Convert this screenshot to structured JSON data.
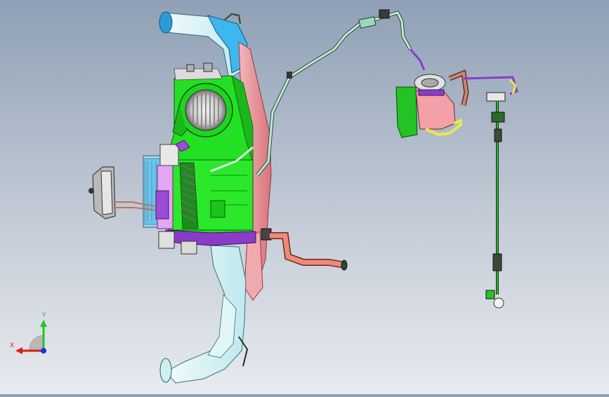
{
  "viewport": {
    "colors": {
      "background_top": "#8fa0b6",
      "background_bottom": "#e8ebef",
      "housing_green": "#22e022",
      "housing_pink": "#e89aa0",
      "duct_light": "#d4f3f6",
      "duct_blue": "#38b7f2",
      "pipe_copper": "#e8826e",
      "purple": "#8a3cc8"
    }
  },
  "triad": {
    "y_label": "Y",
    "x_label": "X",
    "y_color": "#1ec81e",
    "x_color": "#e01818",
    "z_color": "#1a2fe0"
  }
}
